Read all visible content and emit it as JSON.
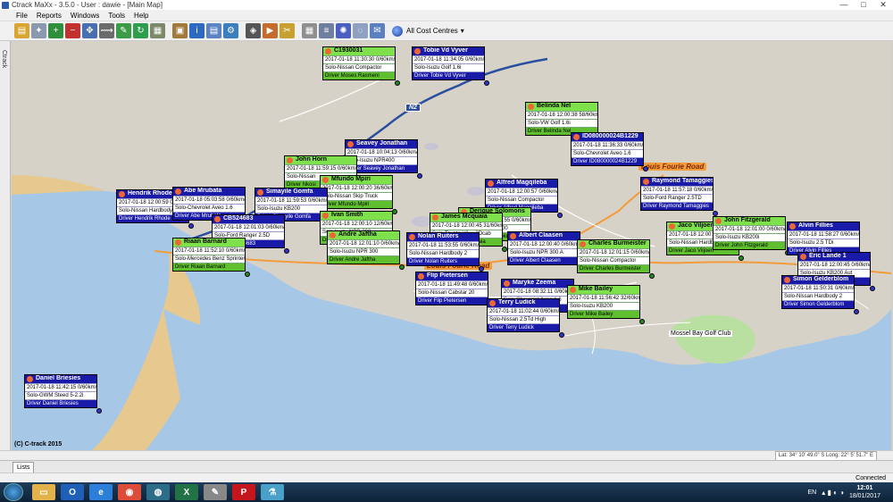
{
  "window": {
    "title": "Ctrack MaXx - 3.5.0 - User : dawie - [Main Map]",
    "buttons": [
      "—",
      "□",
      "✕"
    ]
  },
  "menu": [
    "File",
    "Reports",
    "Windows",
    "Tools",
    "Help"
  ],
  "toolbar": {
    "icons": [
      "folder-icon",
      "satellite-icon",
      "zoom-in-icon",
      "zoom-out-icon",
      "pan-icon",
      "route-icon",
      "edit-icon",
      "refresh-icon",
      "grid-icon",
      "truck-icon",
      "info-icon",
      "table-icon",
      "settings-icon",
      "geofence-icon",
      "vehicle-icon",
      "tools-icon",
      "map-icon",
      "layers-icon",
      "satellite-view-icon",
      "chat-icon",
      "message-icon"
    ],
    "cost_centre": "All Cost Centres"
  },
  "sidetab": {
    "label": "Ctrack"
  },
  "map": {
    "road_labels": [
      "Louis Fourie Road",
      "Louis Fourie Road"
    ],
    "route_badges": [
      "N2",
      "N2"
    ],
    "place_labels": [
      "Mossel Bay Golf Club"
    ],
    "copyright": "(C) C-track 2015",
    "coords": "Lat: 34° 10' 49.0\" S   Long: 22° 5' 51.7\" E",
    "vehicles": [
      {
        "name": "Tobie Vd Vyver",
        "time": "2017-01-18 11:34:05",
        "speed": "0/60km/h",
        "vehicle": "Solo-Isuzu Golf 1.6i",
        "driver": "Tobie Vd Vyver",
        "color": "blue"
      },
      {
        "name": "C1930031",
        "time": "2017-01-18 11:30:30",
        "speed": "0/60km/h",
        "vehicle": "Solo-Nissan Compactor",
        "driver": "Moses Rasmeni",
        "color": "green"
      },
      {
        "name": "Belinda Nel",
        "time": "2017-01-18 12:00:38",
        "speed": "58/60km/h",
        "vehicle": "Solo-VW Golf 1.6i",
        "driver": "Belinda Nel",
        "color": "green"
      },
      {
        "name": "ID080000024B1229",
        "time": "2017-01-18 11:36:33",
        "speed": "0/60km/h",
        "vehicle": "Solo-Chevrolet Aveo 1.6",
        "driver": "ID080000024B1229",
        "color": "blue"
      },
      {
        "name": "Seavey Jonathan",
        "time": "2017-01-18 10:04:13",
        "speed": "0/60km/h",
        "vehicle": "Solo-Isuzu NPR400",
        "driver": "Seavey Jonathan",
        "color": "blue"
      },
      {
        "name": "John Horn",
        "time": "2017-01-18 11:59:15",
        "speed": "0/60km/h",
        "vehicle": "Solo-Nissan",
        "driver": "Nkosi",
        "color": "green"
      },
      {
        "name": "Mfundo Mpiri",
        "time": "2017-01-18 12:00:20",
        "speed": "36/60km/h",
        "vehicle": "Solo-Nissan Skip Truck",
        "driver": "Mfundo Mpiri",
        "color": "green"
      },
      {
        "name": "Simayile Gomfa",
        "time": "2017-01-18 11:59:53",
        "speed": "0/60km/h",
        "vehicle": "Solo-Isuzu KB200",
        "driver": "Simayile Gomfa",
        "color": "blue"
      },
      {
        "name": "Hendrik Rhode",
        "time": "2017-01-18 12:00:59",
        "speed": "0/60km/h",
        "vehicle": "Solo-Nissan Hardbody 2",
        "driver": "Hendrik Rhode",
        "color": "blue"
      },
      {
        "name": "Abe Mrubata",
        "time": "2017-01-18 05:03:58",
        "speed": "0/60km/h",
        "vehicle": "Solo-Chevrolet Aveo 1.6",
        "driver": "Abe Mrubata",
        "color": "white"
      },
      {
        "name": "CB524683",
        "time": "2017-01-18 12:01:03",
        "speed": "0/60km/h",
        "vehicle": "Solo-Ford Ranger 2.5D",
        "driver": "CB524683",
        "color": "blue"
      },
      {
        "name": "Ivan Smith",
        "time": "2017-01-18 12:00:10",
        "speed": "12/60km/h",
        "vehicle": "Solo-Isuzu NPR 300",
        "driver": "Ivan Smith",
        "color": "green"
      },
      {
        "name": "Andre Jaftha",
        "time": "2017-01-18 12:01:10",
        "speed": "0/60km/h",
        "vehicle": "Solo-Isuzu NPR 300",
        "driver": "Andre Jaftha",
        "color": "green"
      },
      {
        "name": "Riaan Barnard",
        "time": "2017-01-18 11:52:10",
        "speed": "0/60km/h",
        "vehicle": "Solo-Mercedes Benz Sprinter",
        "driver": "Riaan Barnard",
        "color": "green"
      },
      {
        "name": "Alfred Magqileba",
        "time": "2017-01-18 12:00:57",
        "speed": "0/60km/h",
        "vehicle": "Solo-Nissan Compactor",
        "driver": "Alfred Magqileba",
        "color": "blue"
      },
      {
        "name": "Derique Solomons",
        "time": "2017-01-18 11:57:55",
        "speed": "0/60km/h",
        "vehicle": "Solo-Isuzu NPR400",
        "driver": "Derique Solomons",
        "color": "green"
      },
      {
        "name": "James Mcquaia",
        "time": "2017-01-18 12:00:45",
        "speed": "31/60km/h",
        "vehicle": "Solo-Toyota Hilux 2Dcab",
        "driver": "James Mcquaia",
        "color": "green"
      },
      {
        "name": "Albert Claasen",
        "time": "2017-01-18 12:00:40",
        "speed": "0/60km/h",
        "vehicle": "Solo-Isuzu NPR 300 A",
        "driver": "Albert Claasen",
        "color": "blue"
      },
      {
        "name": "Raymond Tamaggies",
        "time": "2017-01-18 11:57:18",
        "speed": "0/60km/h",
        "vehicle": "Solo-Ford Ranger 2.5TD",
        "driver": "Raymond Tamaggies",
        "color": "blue"
      },
      {
        "name": "Charles Burmeister",
        "time": "2017-01-18 12:01:15",
        "speed": "0/60km/h",
        "vehicle": "Solo-Nissan Compactor",
        "driver": "Charles Burmeister",
        "color": "green"
      },
      {
        "name": "Jaco Viljoen",
        "time": "2017-01-18 12:00:39",
        "speed": "0/60km/h",
        "vehicle": "Solo-Nissan Hardbody",
        "driver": "Jaco Viljoen",
        "color": "green"
      },
      {
        "name": "John Fitzgerald",
        "time": "2017-01-18 12:01:00",
        "speed": "0/60km/h",
        "vehicle": "Solo-Isuzu KB200i",
        "driver": "John Fitzgerald",
        "color": "green"
      },
      {
        "name": "Alvin Fillies",
        "time": "2017-01-18 11:58:27",
        "speed": "0/60km/h",
        "vehicle": "Solo-Isuzu 2.5 TDi",
        "driver": "Alvin Fillies",
        "color": "blue"
      },
      {
        "name": "Eric Lande 1",
        "time": "2017-01-18 12:00:45",
        "speed": "0/60km/h",
        "vehicle": "Solo-Isuzu KB200 Aut",
        "driver": "Eric Lande 1",
        "color": "blue"
      },
      {
        "name": "Simon Gelderblom",
        "time": "2017-01-18 11:50:31",
        "speed": "0/60km/h",
        "vehicle": "Solo-Nissan Hardbody 2",
        "driver": "Simon Gelderblom",
        "color": "blue"
      },
      {
        "name": "Flip Pietersen",
        "time": "2017-01-18 11:49:48",
        "speed": "0/60km/h",
        "vehicle": "Solo-Nissan Cabstar 20",
        "driver": "Flip Pietersen",
        "color": "blue"
      },
      {
        "name": "Maryke Zeema",
        "time": "2017-01-18 08:32:11",
        "speed": "0/60km/h",
        "vehicle": "Solo-Chevrolet Aveo 1.6",
        "driver": "Maryke Zeema",
        "color": "blue"
      },
      {
        "name": "Mike Bailey",
        "time": "2017-01-18 11:56:42",
        "speed": "32/60km/h",
        "vehicle": "Solo-Isuzu KB200",
        "driver": "Mike Bailey",
        "color": "green"
      },
      {
        "name": "Terry Ludick",
        "time": "2017-01-18 11:02:44",
        "speed": "0/60km/h",
        "vehicle": "Solo-Nissan 2.5Td High",
        "driver": "Terry Ludick",
        "color": "blue"
      },
      {
        "name": "Nolan Ruiters",
        "time": "2017-01-18 11:53:55",
        "speed": "0/60km/h",
        "vehicle": "Solo-Nissan Hardbody 2",
        "driver": "Nolan Ruiters",
        "color": "blue"
      },
      {
        "name": "Daniel Briesies",
        "time": "2017-01-18 11:42:15",
        "speed": "0/60km/h",
        "vehicle": "Solo-GWM Steed 5-2.2i",
        "driver": "Daniel Briesies",
        "color": "blue"
      }
    ]
  },
  "lists_tab": "Lists",
  "status": "Connected",
  "taskbar": {
    "apps": [
      "explorer-icon",
      "outlook-icon",
      "ie-icon",
      "chrome-icon",
      "ctrack-icon",
      "excel-icon",
      "paint-icon",
      "pdf-icon",
      "flask-icon"
    ],
    "lang": "EN",
    "time": "12:01",
    "date": "18/01/2017"
  },
  "colors": {
    "vehicle_blue": "#1a1aa8",
    "vehicle_green": "#7ee04a",
    "road_orange": "#f49b3b",
    "sea": "#a7c7e7",
    "land": "#d7d2c8",
    "beach": "#e7c98f"
  }
}
